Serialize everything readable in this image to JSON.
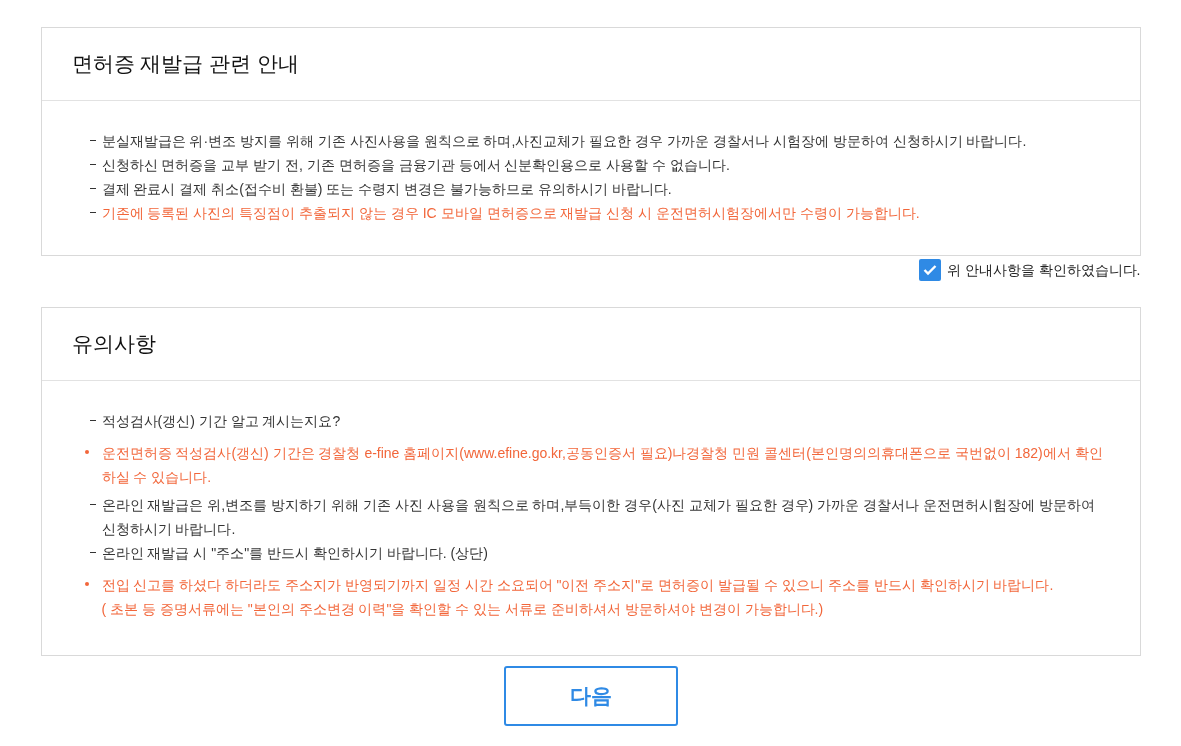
{
  "sections": [
    {
      "title": "면허증 재발급 관련 안내",
      "items": [
        {
          "kind": "dash",
          "highlight": false,
          "text": "분실재발급은 위·변조 방지를 위해 기존 사진사용을 원칙으로 하며,사진교체가 필요한 경우 가까운 경찰서나 시험장에 방문하여 신청하시기 바랍니다."
        },
        {
          "kind": "dash",
          "highlight": false,
          "text": "신청하신 면허증을 교부 받기 전, 기존 면허증을 금융기관 등에서 신분확인용으로 사용할 수 없습니다."
        },
        {
          "kind": "dash",
          "highlight": false,
          "text": "결제 완료시 결제 취소(접수비 환불) 또는 수령지 변경은 불가능하므로 유의하시기 바랍니다."
        },
        {
          "kind": "dash",
          "highlight": true,
          "text": "기존에 등록된 사진의 특징점이 추출되지 않는 경우 IC 모바일 면허증으로 재발급 신청 시 운전면허시험장에서만 수령이 가능합니다."
        }
      ]
    },
    {
      "title": "유의사항",
      "items": [
        {
          "kind": "dash",
          "highlight": false,
          "text": "적성검사(갱신) 기간 알고 계시는지요?"
        },
        {
          "kind": "bullet",
          "highlight": true,
          "text": "운전면허증 적성검사(갱신) 기간은 경찰청 e-fine 홈페이지(www.efine.go.kr,공동인증서 필요)나경찰청 민원 콜센터(본인명의의휴대폰으로 국번없이 182)에서 확인하실 수 있습니다."
        },
        {
          "kind": "dash",
          "highlight": false,
          "text": "온라인 재발급은 위,변조를 방지하기 위해 기존 사진 사용을 원칙으로 하며,부득이한 경우(사진 교체가 필요한 경우) 가까운 경찰서나 운전면허시험장에 방문하여 신청하시기 바랍니다."
        },
        {
          "kind": "dash",
          "highlight": false,
          "text": "온라인 재발급 시 \"주소\"를 반드시 확인하시기 바랍니다. (상단)"
        },
        {
          "kind": "bullet",
          "highlight": true,
          "text": "전입 신고를 하셨다 하더라도 주소지가 반영되기까지 일정 시간 소요되어 \"이전 주소지\"로 면허증이 발급될 수 있으니 주소를 반드시 확인하시기 바랍니다.",
          "note": "( 초본 등 증명서류에는 \"본인의 주소변경 이력\"을 확인할 수 있는 서류로 준비하셔서 방문하셔야 변경이 가능합니다.)"
        }
      ]
    }
  ],
  "confirm": {
    "label": "위 안내사항을 확인하였습니다.",
    "checked": true
  },
  "next_button": "다음"
}
